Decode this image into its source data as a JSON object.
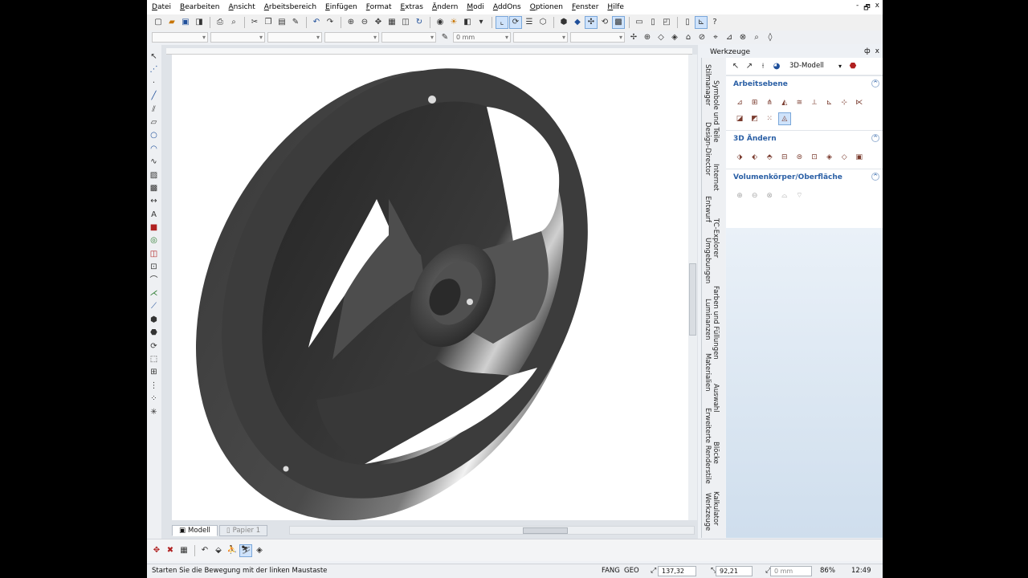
{
  "menu": [
    "Datei",
    "Bearbeiten",
    "Ansicht",
    "Arbeitsbereich",
    "Einfügen",
    "Format",
    "Extras",
    "Ändern",
    "Modi",
    "AddOns",
    "Optionen",
    "Fenster",
    "Hilfe"
  ],
  "window_controls": [
    "-",
    "🗗",
    "x"
  ],
  "toolbar2": {
    "thickness_value": "0 mm"
  },
  "canvas": {
    "tabs": [
      {
        "label": "Modell"
      },
      {
        "label": "Papier 1"
      }
    ]
  },
  "panel": {
    "title": "Werkzeuge",
    "controls": [
      "ф",
      "x"
    ],
    "mode": "3D-Modell",
    "sections": [
      {
        "title": "Arbeitsebene",
        "collapse": "^",
        "tool_count": 15
      },
      {
        "title": "3D Ändern",
        "collapse": "^",
        "tool_count": 8
      },
      {
        "title": "Volumenkörper/Oberfläche",
        "collapse": "^",
        "tool_count": 5
      }
    ],
    "vertical_tabs": [
      "Stilmanager",
      "Symbole und Teile",
      "Design-Director",
      "Internet",
      "Entwurf",
      "TC-Explorer",
      "Umgebungen",
      "Farben und Füllungen",
      "Luminanzen",
      "Materialien",
      "Auswahl",
      "Erweiterte Renderstile",
      "Blöcke",
      "Werkzeuge",
      "Kalkulator"
    ]
  },
  "status": {
    "message": "Starten Sie die Bewegung mit der linken Maustaste",
    "fang": "FANG",
    "geo": "GEO",
    "x": "137,32 mm",
    "y": "92,21 mm",
    "z": "0 mm",
    "zoom": "86%",
    "time": "12:49"
  },
  "colors": {
    "accent": "#2a5fa5",
    "panel_gradient": "#cfdeed"
  }
}
